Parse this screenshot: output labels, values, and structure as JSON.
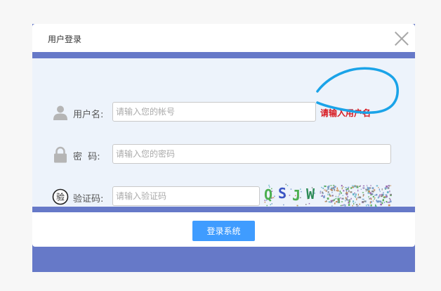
{
  "dialog": {
    "title": "用户登录"
  },
  "form": {
    "username": {
      "label": "用户名:",
      "placeholder": "请输入您的帐号",
      "value": "",
      "error": "请输入用户名"
    },
    "password": {
      "label": "密  码:",
      "placeholder": "请输入您的密码",
      "value": ""
    },
    "captcha": {
      "label": "验证码:",
      "placeholder": "请输入验证码",
      "value": "",
      "icon_text": "验",
      "image_text": [
        "Q",
        "S",
        "J",
        "W"
      ],
      "image_colors": [
        "#4caf50",
        "#3b55c4",
        "#4caf50",
        "#2e8b57"
      ]
    }
  },
  "buttons": {
    "login": "登录系统"
  },
  "icons": {
    "user": "user-icon",
    "lock": "lock-icon",
    "captcha": "captcha-badge-icon",
    "close": "close-icon"
  },
  "colors": {
    "accent": "#6679c8",
    "button": "#3f9cff",
    "error": "#d71920",
    "annotation": "#1aa3e8"
  }
}
